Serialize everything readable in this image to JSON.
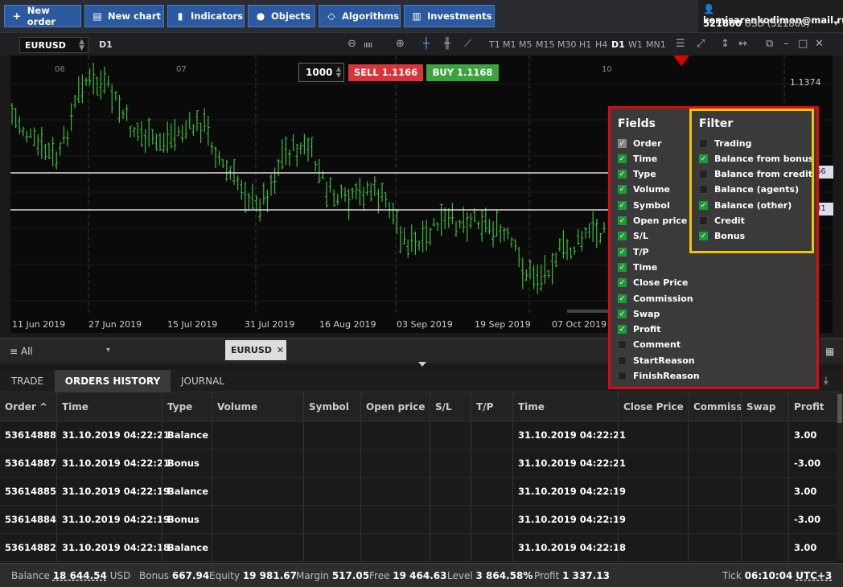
{
  "toolbar": {
    "new_order": "New order",
    "new_chart": "New chart",
    "indicators": "Indicators",
    "objects": "Objects",
    "algorithms": "Algorithms",
    "investments": "Investments"
  },
  "account": {
    "email": "komisarenkodimon@mail.ru",
    "number": "521860",
    "currency_line": "USD (521860)"
  },
  "chart_header": {
    "symbol": "EURUSD",
    "timeframe_current": "D1",
    "timeframes": [
      "T1",
      "M1",
      "M5",
      "M15",
      "M30",
      "H1",
      "H4",
      "D1",
      "W1",
      "MN1"
    ],
    "active_timeframe": "D1"
  },
  "chart": {
    "lot": "1000",
    "sell_label": "SELL 1.1166",
    "buy_label": "BUY 1.1168",
    "price_label": "1.1374",
    "price_tag_1": "66",
    "price_tag_2": "31",
    "top_labels": [
      "06",
      "07",
      "10"
    ],
    "x_labels": [
      "11 Jun 2019",
      "27 Jun 2019",
      "15 Jul 2019",
      "31 Jul 2019",
      "16 Aug 2019",
      "03 Sep 2019",
      "19 Sep 2019",
      "07 Oct 2019"
    ],
    "candle_color": "#3dbb3d"
  },
  "middle": {
    "filter_label": "All",
    "symbol_tab": "EURUSD"
  },
  "tabs": {
    "trade": "TRADE",
    "orders_history": "ORDERS HISTORY",
    "journal": "JOURNAL",
    "active": "ORDERS HISTORY"
  },
  "table": {
    "headers": [
      "Order ^",
      "Time",
      "Type",
      "Volume",
      "Symbol",
      "Open price",
      "S/L",
      "T/P",
      "Time",
      "Close Price",
      "Commissi",
      "Swap",
      "Profit"
    ],
    "rows": [
      {
        "order": "53614888",
        "time": "31.10.2019 04:22:21",
        "type": "Balance",
        "close_time": "31.10.2019 04:22:21",
        "profit": "3.00"
      },
      {
        "order": "53614887",
        "time": "31.10.2019 04:22:21",
        "type": "Bonus",
        "close_time": "31.10.2019 04:22:21",
        "profit": "-3.00"
      },
      {
        "order": "53614885",
        "time": "31.10.2019 04:22:19",
        "type": "Balance",
        "close_time": "31.10.2019 04:22:19",
        "profit": "3.00"
      },
      {
        "order": "53614884",
        "time": "31.10.2019 04:22:19",
        "type": "Bonus",
        "close_time": "31.10.2019 04:22:19",
        "profit": "-3.00"
      },
      {
        "order": "53614882",
        "time": "31.10.2019 04:22:18",
        "type": "Balance",
        "close_time": "31.10.2019 04:22:18",
        "profit": "3.00"
      }
    ]
  },
  "status": {
    "balance_label": "Balance",
    "balance": "18 644.54",
    "balance_cur": "USD",
    "bonus_label": "Bonus",
    "bonus": "667.94",
    "equity_label": "Equity",
    "equity": "19 981.67",
    "margin_label": "Margin",
    "margin": "517.05",
    "free_label": "Free",
    "free": "19 464.63",
    "level_label": "Level",
    "level": "3 864.58%",
    "profit_label": "Profit",
    "profit": "1 337.13",
    "tick_label": "Tick",
    "tick": "06:10:04",
    "tz": "UTC+3"
  },
  "panel": {
    "fields_title": "Fields",
    "filter_title": "Filter",
    "fields": [
      {
        "label": "Order",
        "state": "disabled"
      },
      {
        "label": "Time",
        "state": "on"
      },
      {
        "label": "Type",
        "state": "on"
      },
      {
        "label": "Volume",
        "state": "on"
      },
      {
        "label": "Symbol",
        "state": "on"
      },
      {
        "label": "Open price",
        "state": "on"
      },
      {
        "label": "S/L",
        "state": "on"
      },
      {
        "label": "T/P",
        "state": "on"
      },
      {
        "label": "Time",
        "state": "on"
      },
      {
        "label": "Close Price",
        "state": "on"
      },
      {
        "label": "Commission",
        "state": "on"
      },
      {
        "label": "Swap",
        "state": "on"
      },
      {
        "label": "Profit",
        "state": "on"
      },
      {
        "label": "Comment",
        "state": "off"
      },
      {
        "label": "StartReason",
        "state": "off"
      },
      {
        "label": "FinishReason",
        "state": "off"
      }
    ],
    "filters": [
      {
        "label": "Trading",
        "state": "off"
      },
      {
        "label": "Balance from bonus",
        "state": "on"
      },
      {
        "label": "Balance from credit",
        "state": "off"
      },
      {
        "label": "Balance (agents)",
        "state": "off"
      },
      {
        "label": "Balance (other)",
        "state": "on"
      },
      {
        "label": "Credit",
        "state": "off"
      },
      {
        "label": "Bonus",
        "state": "on"
      }
    ],
    "highlight_red": "#e00a0a",
    "highlight_yellow": "#f5c400"
  }
}
